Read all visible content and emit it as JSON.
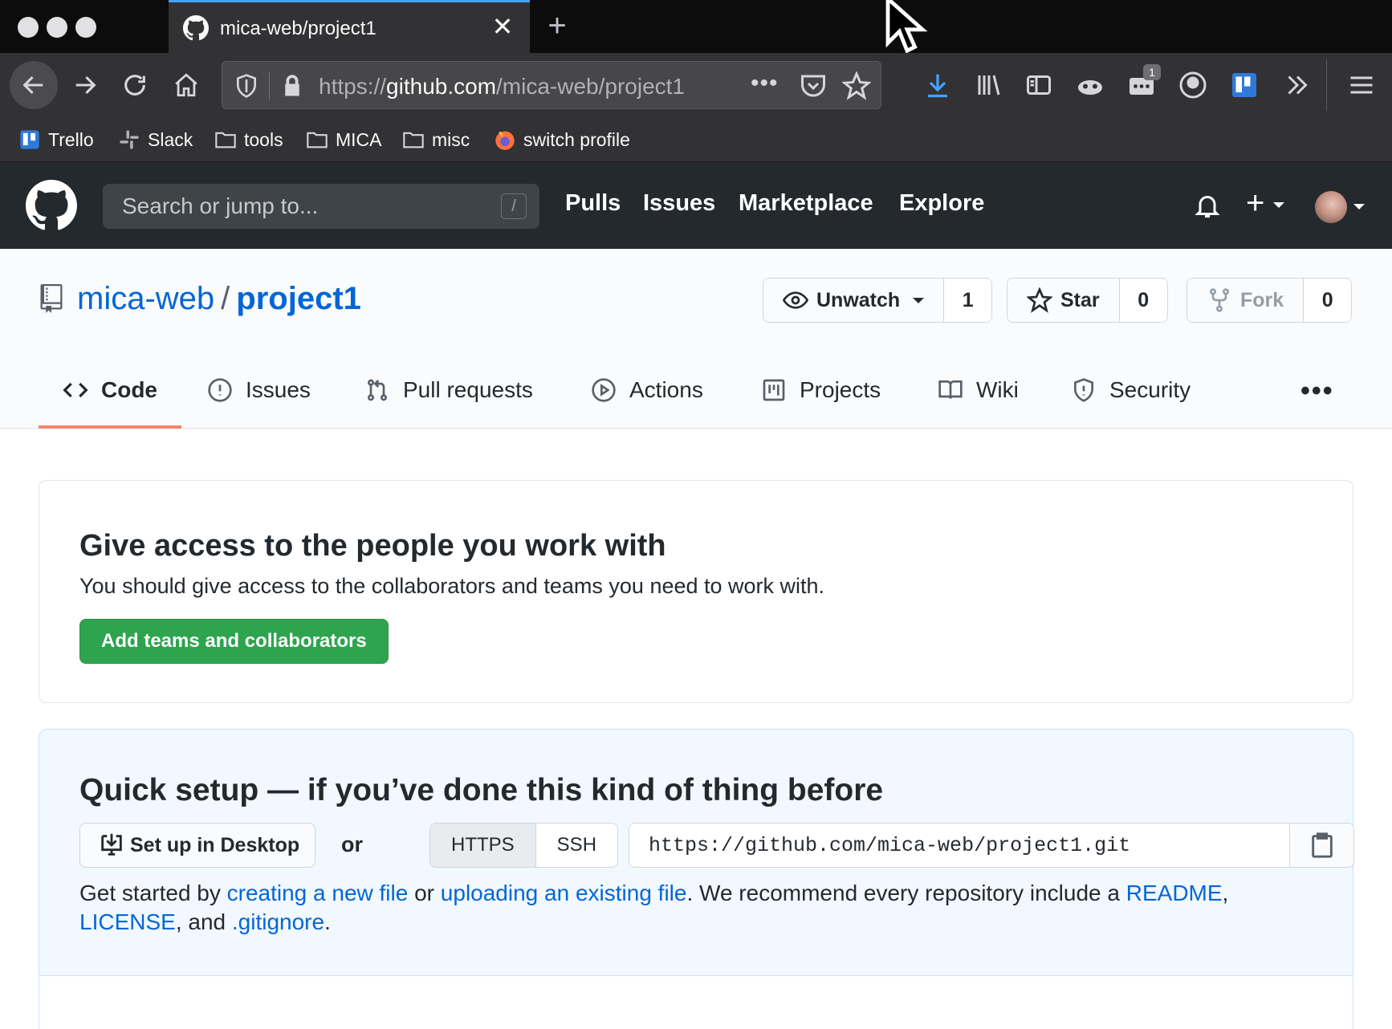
{
  "browser": {
    "tab_title": "mica-web/project1",
    "url_scheme": "https://",
    "url_host": "github.com",
    "url_path": "/mica-web/project1",
    "extension_badge": "1",
    "bookmarks": [
      {
        "label": "Trello",
        "icon": "trello-icon"
      },
      {
        "label": "Slack",
        "icon": "slack-icon"
      },
      {
        "label": "tools",
        "icon": "folder-icon"
      },
      {
        "label": "MICA",
        "icon": "folder-icon"
      },
      {
        "label": "misc",
        "icon": "folder-icon"
      },
      {
        "label": "switch profile",
        "icon": "firefox-icon"
      }
    ]
  },
  "github_header": {
    "search_placeholder": "Search or jump to...",
    "search_shortcut": "/",
    "nav": [
      "Pulls",
      "Issues",
      "Marketplace",
      "Explore"
    ],
    "plus": "+"
  },
  "repo": {
    "owner": "mica-web",
    "separator": "/",
    "name": "project1",
    "unwatch_label": "Unwatch",
    "watch_count": "1",
    "star_label": "Star",
    "star_count": "0",
    "fork_label": "Fork",
    "fork_count": "0",
    "tabs": [
      "Code",
      "Issues",
      "Pull requests",
      "Actions",
      "Projects",
      "Wiki",
      "Security"
    ],
    "more": "•••"
  },
  "access": {
    "title": "Give access to the people you work with",
    "description": "You should give access to the collaborators and teams you need to work with.",
    "button": "Add teams and collaborators"
  },
  "setup": {
    "title": "Quick setup — if you’ve done this kind of thing before",
    "desktop_button": "Set up in Desktop",
    "or": "or",
    "https_label": "HTTPS",
    "ssh_label": "SSH",
    "clone_url": "https://github.com/mica-web/project1.git",
    "text_1": "Get started by ",
    "link_new_file": "creating a new file",
    "text_2": " or ",
    "link_upload": "uploading an existing file",
    "text_3": ". We recommend every repository include a ",
    "link_readme": "README",
    "text_4": ", ",
    "link_license": "LICENSE",
    "text_5": ", and ",
    "link_gitignore": ".gitignore",
    "text_6": "."
  },
  "colors": {
    "primary_link": "#0366d6",
    "green_button": "#2ea44f",
    "selected_tab_underline": "#f9826c",
    "header_bg": "#24292e"
  }
}
